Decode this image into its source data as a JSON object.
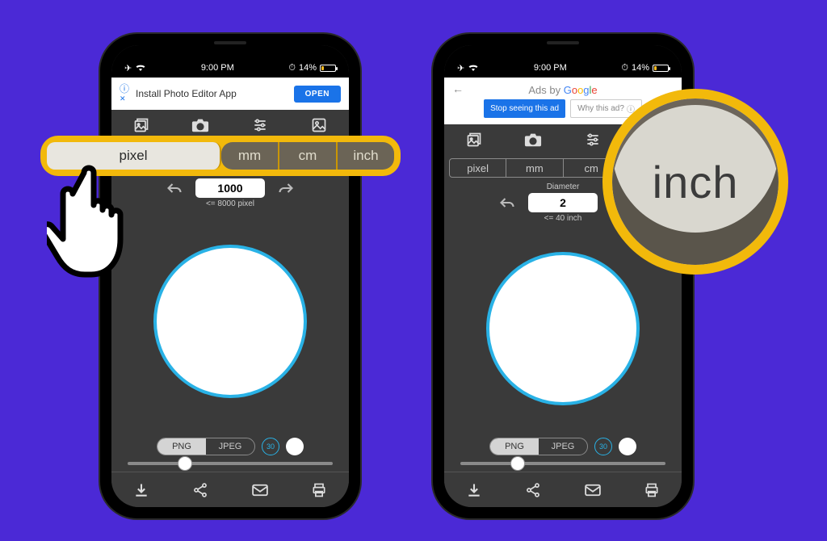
{
  "status": {
    "time": "9:00 PM",
    "battery": "14%"
  },
  "ad": {
    "title": "Install Photo Editor App",
    "open": "OPEN"
  },
  "googleads": {
    "title": "Ads by",
    "brand": "Google",
    "stop": "Stop seeing this ad",
    "why": "Why this ad?"
  },
  "units": {
    "pixel": "pixel",
    "mm": "mm",
    "cm": "cm",
    "inch": "inch"
  },
  "diameter": {
    "label": "Diameter",
    "value_left": "1000",
    "limit_left": "<= 8000 pixel",
    "value_right": "2",
    "limit_right": "<= 40 inch"
  },
  "formats": {
    "png": "PNG",
    "jpeg": "JPEG",
    "quality": "30"
  },
  "magnifier": {
    "text": "inch"
  }
}
